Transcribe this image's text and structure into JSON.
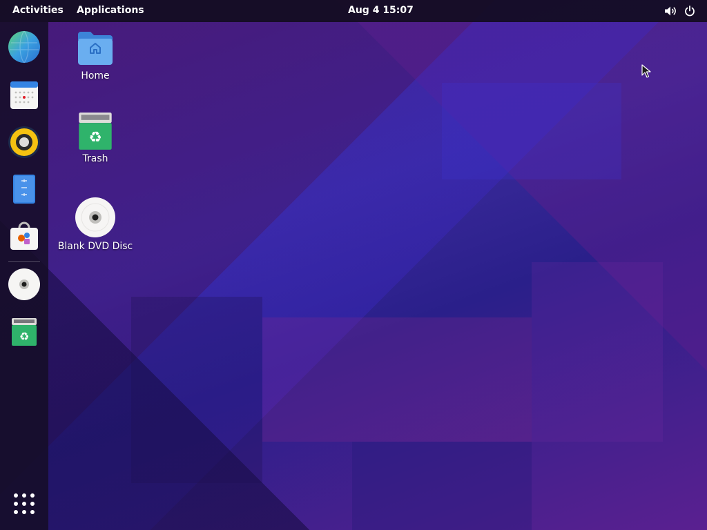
{
  "topbar": {
    "activities": "Activities",
    "applications": "Applications",
    "clock": "Aug 4  15:07",
    "icons": {
      "sound": "speaker-icon",
      "power": "power-icon"
    }
  },
  "dock": {
    "items": [
      {
        "id": "web-browser",
        "icon": "globe-icon"
      },
      {
        "id": "calendar",
        "icon": "calendar-icon"
      },
      {
        "id": "rhythmbox",
        "icon": "speaker-app-icon"
      },
      {
        "id": "text-editor",
        "icon": "document-icon"
      },
      {
        "id": "software",
        "icon": "shopping-bag-icon"
      },
      {
        "id": "dvd",
        "icon": "disc-icon"
      },
      {
        "id": "trash",
        "icon": "trash-icon"
      }
    ],
    "show_apps_icon": "grid-icon"
  },
  "desktop": {
    "icons": [
      {
        "label": "Home",
        "icon": "folder-home-icon"
      },
      {
        "label": "Trash",
        "icon": "trash-icon"
      },
      {
        "label": "Blank DVD Disc",
        "icon": "disc-icon"
      }
    ]
  },
  "colors": {
    "topbar_bg": "#120c20",
    "dock_bg": "#160e28",
    "wallpaper_primary": "#3a1a6e",
    "folder_blue": "#5fa8f0",
    "trash_green": "#2fb36b"
  }
}
